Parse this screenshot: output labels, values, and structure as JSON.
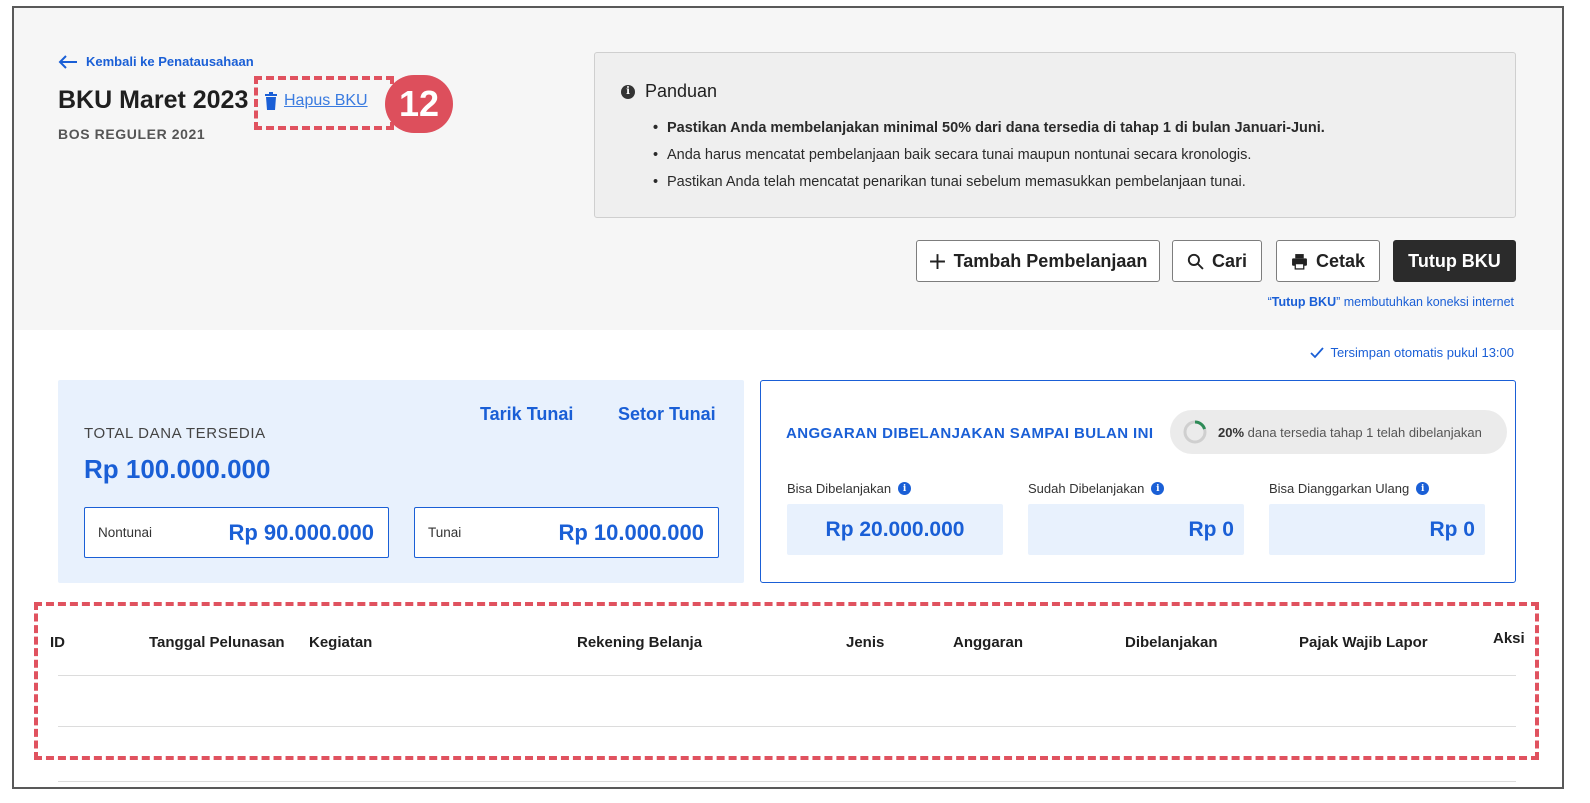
{
  "back_link": {
    "label": "Kembali ke Penatausahaan"
  },
  "page": {
    "title": "BKU Maret 2023",
    "subtitle": "BOS REGULER 2021"
  },
  "delete_action": {
    "label": "Hapus BKU"
  },
  "annotation": {
    "badge": "12",
    "color": "#dd4f5c"
  },
  "guide": {
    "title": "Panduan",
    "items": [
      "Pastikan Anda membelanjakan minimal 50% dari dana tersedia di tahap 1 di bulan Januari-Juni.",
      "Anda harus mencatat pembelanjaan baik secara tunai maupun nontunai secara kronologis.",
      "Pastikan Anda telah mencatat penarikan tunai sebelum memasukkan pembelanjaan tunai."
    ]
  },
  "toolbar": {
    "add_label": "Tambah Pembelanjaan",
    "search_label": "Cari",
    "print_label": "Cetak",
    "close_label": "Tutup BKU",
    "note_quote_open": "“",
    "note_bold": "Tutup BKU",
    "note_rest": "” membutuhkan koneksi internet"
  },
  "autosave": {
    "label": "Tersimpan otomatis pukul 13:00"
  },
  "dana": {
    "label": "TOTAL DANA TERSEDIA",
    "value": "Rp 100.000.000",
    "tarik_label": "Tarik Tunai",
    "setor_label": "Setor Tunai",
    "nontunai_label": "Nontunai",
    "nontunai_value": "Rp 90.000.000",
    "tunai_label": "Tunai",
    "tunai_value": "Rp 10.000.000"
  },
  "anggaran": {
    "title": "ANGGARAN DIBELANJAKAN SAMPAI BULAN INI",
    "pill_percent": "20%",
    "pill_text": " dana tersedia tahap 1 telah dibelanjakan",
    "progress_fraction": 0.2,
    "stats": [
      {
        "label": "Bisa Dibelanjakan",
        "value": "Rp 20.000.000"
      },
      {
        "label": "Sudah Dibelanjakan",
        "value": "Rp 0"
      },
      {
        "label": "Bisa Dianggarkan Ulang",
        "value": "Rp 0"
      }
    ]
  },
  "table": {
    "columns": [
      "ID",
      "Tanggal Pelunasan",
      "Kegiatan",
      "Rekening Belanja",
      "Jenis",
      "Anggaran",
      "Dibelanjakan",
      "Pajak Wajib Lapor",
      "Aksi"
    ]
  },
  "colors": {
    "primary": "#1a5fd6",
    "dark_button": "#2b2b2b",
    "highlight": "#e0525f",
    "card_bg": "#e8f1fd"
  }
}
